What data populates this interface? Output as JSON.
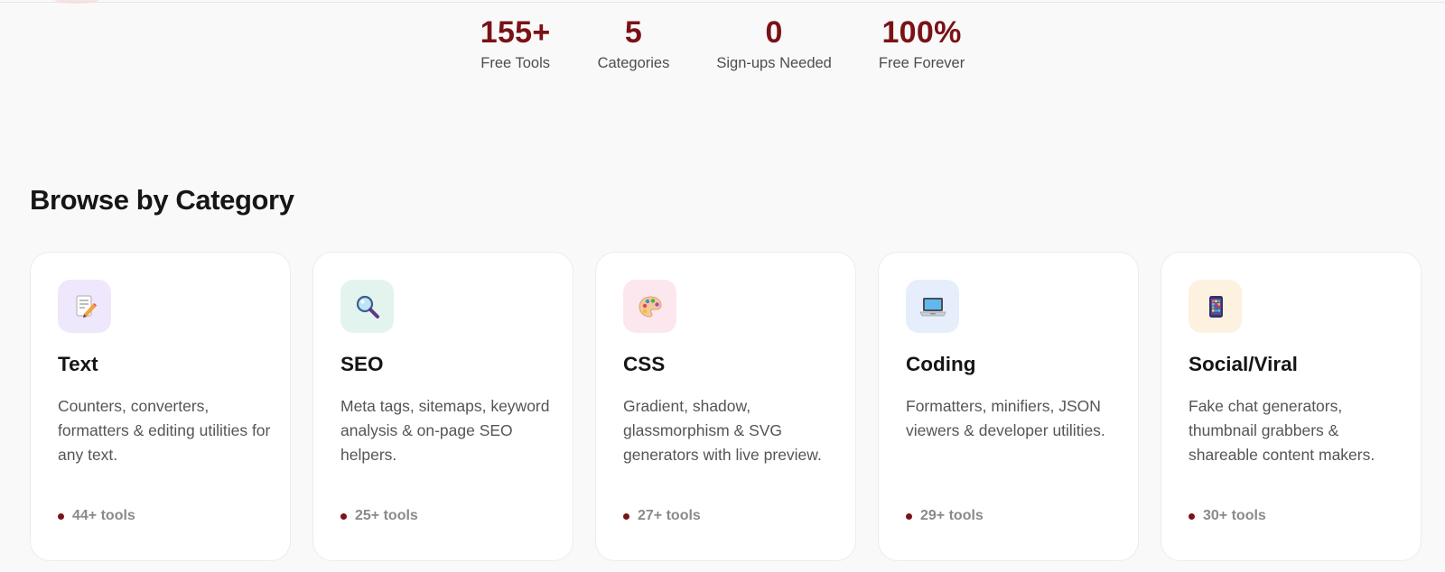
{
  "stats": [
    {
      "value": "155+",
      "label": "Free Tools"
    },
    {
      "value": "5",
      "label": "Categories"
    },
    {
      "value": "0",
      "label": "Sign-ups Needed"
    },
    {
      "value": "100%",
      "label": "Free Forever"
    }
  ],
  "section_title": "Browse by Category",
  "categories": [
    {
      "title": "Text",
      "description": "Counters, converters, formatters & editing utilities for any text.",
      "count": "44+ tools",
      "icon": "memo-icon",
      "icon_bg": "#efe7fb"
    },
    {
      "title": "SEO",
      "description": "Meta tags, sitemaps, keyword analysis & on-page SEO helpers.",
      "count": "25+ tools",
      "icon": "magnifier-icon",
      "icon_bg": "#e3f4ee"
    },
    {
      "title": "CSS",
      "description": "Gradient, shadow, glassmorphism & SVG generators with live preview.",
      "count": "27+ tools",
      "icon": "palette-icon",
      "icon_bg": "#fde7ee"
    },
    {
      "title": "Coding",
      "description": "Formatters, minifiers, JSON viewers & developer utilities.",
      "count": "29+ tools",
      "icon": "laptop-icon",
      "icon_bg": "#e6eefc"
    },
    {
      "title": "Social/Viral",
      "description": "Fake chat generators, thumbnail grabbers & shareable content makers.",
      "count": "30+ tools",
      "icon": "phone-apps-icon",
      "icon_bg": "#fdf1e0"
    }
  ],
  "colors": {
    "accent": "#7a1216",
    "background": "#f9f9f9"
  }
}
